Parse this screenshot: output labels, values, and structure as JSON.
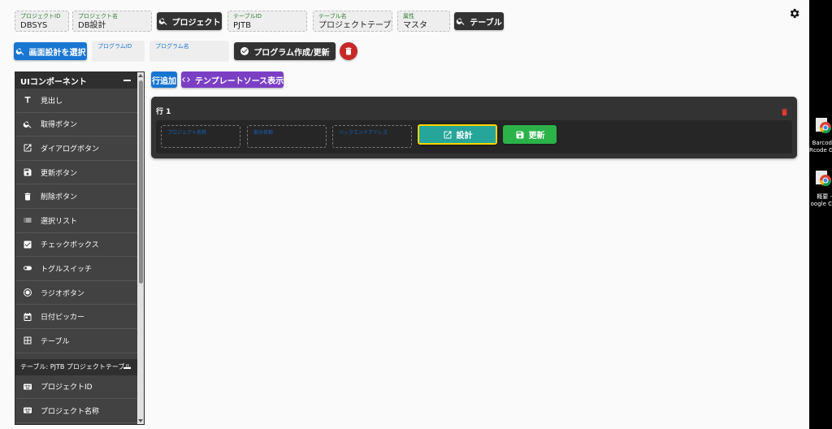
{
  "header": {
    "project_id": {
      "label": "プロジェクトID",
      "value": "DBSYS"
    },
    "project_name": {
      "label": "プロジェクト名",
      "value": "DB設計"
    },
    "project_button": "プロジェクト",
    "table_id": {
      "label": "テーブルID",
      "value": "PJTB"
    },
    "table_name": {
      "label": "テーブル名",
      "value": "プロジェクトテーブ"
    },
    "attribute": {
      "label": "属性",
      "value": "マスタ"
    },
    "table_button": "テーブル"
  },
  "toolbar": {
    "select_screen_button": "画面設計を選択",
    "program_id_label": "プログラムID",
    "program_name_label": "プログラム名",
    "create_program_button": "プログラム作成/更新"
  },
  "actions": {
    "add_row_button": "行追加",
    "template_source_button": "テンプレートソース表示"
  },
  "sidebar": {
    "title": "UIコンポーネント",
    "items": [
      {
        "label": "見出し",
        "icon": "heading-icon"
      },
      {
        "label": "取得ボタン",
        "icon": "search-icon"
      },
      {
        "label": "ダイアログボタン",
        "icon": "open-in-new-icon"
      },
      {
        "label": "更新ボタン",
        "icon": "save-icon"
      },
      {
        "label": "削除ボタン",
        "icon": "trash-icon"
      },
      {
        "label": "選択リスト",
        "icon": "list-icon"
      },
      {
        "label": "チェックボックス",
        "icon": "checkbox-icon"
      },
      {
        "label": "トグルスイッチ",
        "icon": "toggle-icon"
      },
      {
        "label": "ラジオボタン",
        "icon": "radio-icon"
      },
      {
        "label": "日付ピッカー",
        "icon": "calendar-icon"
      },
      {
        "label": "テーブル",
        "icon": "table-icon"
      }
    ],
    "section2_title": "テーブル: PJTB プロジェクトテーブル",
    "section2_items": [
      {
        "label": "プロジェクトID",
        "icon": "keyboard-icon"
      },
      {
        "label": "プロジェクト名称",
        "icon": "keyboard-icon"
      }
    ]
  },
  "row": {
    "title": "行 1",
    "placeholders": [
      "プロジェクト名称",
      "部分名称",
      "バックエンドアドレス"
    ],
    "design_button": "設計",
    "update_button": "更新"
  },
  "desktop": {
    "icon1_label_line1": "Barcod",
    "icon1_label_line2": "Rcode G",
    "icon2_label_line1": "概要 -",
    "icon2_label_line2": "oogle C"
  },
  "colors": {
    "accent_blue": "#1976d2",
    "purple": "#7b3fc4",
    "teal": "#26a69a",
    "green": "#2bb34a",
    "danger": "#c62828",
    "dark": "#333333"
  }
}
